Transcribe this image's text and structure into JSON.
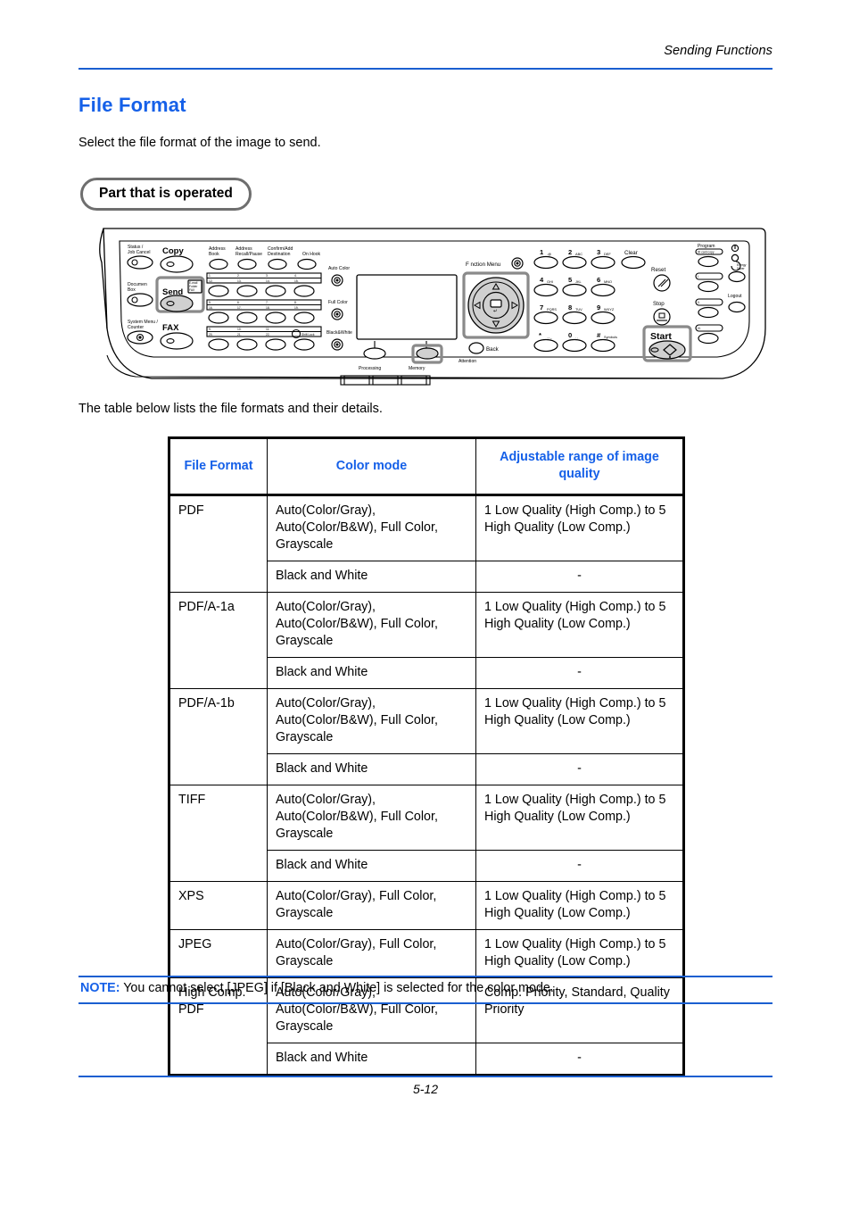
{
  "header": {
    "running_title": "Sending Functions"
  },
  "title": "File Format",
  "intro": "Select the file format of the image to send.",
  "badge": "Part that is operated",
  "table_caption": "The table below lists the file formats and their details.",
  "colors": {
    "accent_blue": "#1560e8",
    "rule_blue": "#1a5fd0",
    "badge_gray": "#6e6e6e",
    "panel_highlight": "#808080",
    "key_fill": "#d9d9d9"
  },
  "table": {
    "headers": [
      "File Format",
      "Color mode",
      "Adjustable range of image quality"
    ],
    "rows": [
      {
        "format": "PDF",
        "span": 2,
        "sub": [
          {
            "color_mode": "Auto(Color/Gray), Auto(Color/B&W), Full Color, Grayscale",
            "quality": "1 Low Quality (High Comp.) to 5 High Quality (Low Comp.)"
          },
          {
            "color_mode": "Black and White",
            "quality": "-"
          }
        ]
      },
      {
        "format": "PDF/A-1a",
        "span": 2,
        "sub": [
          {
            "color_mode": "Auto(Color/Gray), Auto(Color/B&W), Full Color, Grayscale",
            "quality": "1 Low Quality (High Comp.) to 5 High Quality (Low Comp.)"
          },
          {
            "color_mode": "Black and White",
            "quality": "-"
          }
        ]
      },
      {
        "format": "PDF/A-1b",
        "span": 2,
        "sub": [
          {
            "color_mode": "Auto(Color/Gray), Auto(Color/B&W), Full Color, Grayscale",
            "quality": "1 Low Quality (High Comp.) to 5 High Quality (Low Comp.)"
          },
          {
            "color_mode": "Black and White",
            "quality": "-"
          }
        ]
      },
      {
        "format": "TIFF",
        "span": 2,
        "sub": [
          {
            "color_mode": "Auto(Color/Gray), Auto(Color/B&W), Full Color, Grayscale",
            "quality": "1 Low Quality (High Comp.) to 5 High Quality (Low Comp.)"
          },
          {
            "color_mode": "Black and White",
            "quality": "-"
          }
        ]
      },
      {
        "format": "XPS",
        "span": 1,
        "sub": [
          {
            "color_mode": "Auto(Color/Gray), Full Color, Grayscale",
            "quality": "1 Low Quality (High Comp.) to 5 High Quality (Low Comp.)"
          }
        ]
      },
      {
        "format": "JPEG",
        "span": 1,
        "sub": [
          {
            "color_mode": "Auto(Color/Gray), Full Color, Grayscale",
            "quality": "1 Low Quality (High Comp.) to 5 High Quality (Low Comp.)"
          }
        ]
      },
      {
        "format": "High Comp. PDF",
        "span": 2,
        "sub": [
          {
            "color_mode": "Auto(Color/Gray), Auto(Color/B&W), Full Color, Grayscale",
            "quality": "Comp. Priority, Standard, Quality Priority"
          },
          {
            "color_mode": "Black and White",
            "quality": "-"
          }
        ]
      }
    ]
  },
  "note": {
    "label": "NOTE:",
    "text": "You cannot select [JPEG] if [Black and White] is selected for the color mode."
  },
  "footer": {
    "page_number": "5-12"
  },
  "control_panel": {
    "left_keys": [
      {
        "label": "Status / Job Cancel"
      },
      {
        "label": "Document Box"
      },
      {
        "label": "System Menu / Counter"
      }
    ],
    "mode_keys": [
      {
        "label": "Copy"
      },
      {
        "label": "Send",
        "sublabel": "E-mail Folder FAX",
        "highlighted": true
      },
      {
        "label": "FAX"
      }
    ],
    "fax_keys": [
      {
        "label": "Address Book"
      },
      {
        "label": "Address Recall/Pause"
      },
      {
        "label": "Confirm/Add Destination"
      },
      {
        "label": "On Hook"
      }
    ],
    "one_touch_rows": [
      {
        "top": [
          "1.",
          "2.",
          "3.",
          "4."
        ],
        "bottom": [
          "12.",
          "13.",
          "14.",
          "15."
        ]
      },
      {
        "top": [
          "5.",
          "6.",
          "7.",
          "8."
        ],
        "bottom": [
          "16.",
          "17.",
          "18.",
          "19."
        ]
      },
      {
        "top": [
          "9.",
          "10.",
          "11.",
          ""
        ],
        "bottom": [
          "20.",
          "21.",
          "22.",
          ""
        ]
      }
    ],
    "shift_lock": "Shift Lock",
    "color_keys": [
      {
        "label": "Auto Color"
      },
      {
        "label": "Full Color"
      },
      {
        "label": "Black&White"
      }
    ],
    "indicators": [
      {
        "label": "Processing"
      },
      {
        "label": "Memory",
        "highlighted": true
      },
      {
        "label": "Attention"
      }
    ],
    "function_menu": "F nction Menu",
    "ok_label": "OK",
    "back_label": "Back",
    "keypad": [
      {
        "num": "1",
        "letters": ".@"
      },
      {
        "num": "2",
        "letters": "ABC"
      },
      {
        "num": "3",
        "letters": "DEF"
      },
      {
        "num": "4",
        "letters": "GHI"
      },
      {
        "num": "5",
        "letters": "JKL"
      },
      {
        "num": "6",
        "letters": "MNO"
      },
      {
        "num": "7",
        "letters": "PQRS"
      },
      {
        "num": "8",
        "letters": "TUV"
      },
      {
        "num": "9",
        "letters": "WXYZ"
      },
      {
        "num": "*",
        "letters": ".,-_"
      },
      {
        "num": "0",
        "letters": ". ,"
      },
      {
        "num": "#",
        "letters": "Symbols"
      }
    ],
    "clear_label": "Clear",
    "reset_label": "Reset",
    "stop_label": "Stop",
    "start_label": "Start",
    "program_label": "Program",
    "id_card_copy_label": "ID card copy",
    "program_slots": [
      "I.",
      "II.",
      "III."
    ],
    "energy_saver_label": "Energy Saver",
    "logout_label": "Logout"
  }
}
